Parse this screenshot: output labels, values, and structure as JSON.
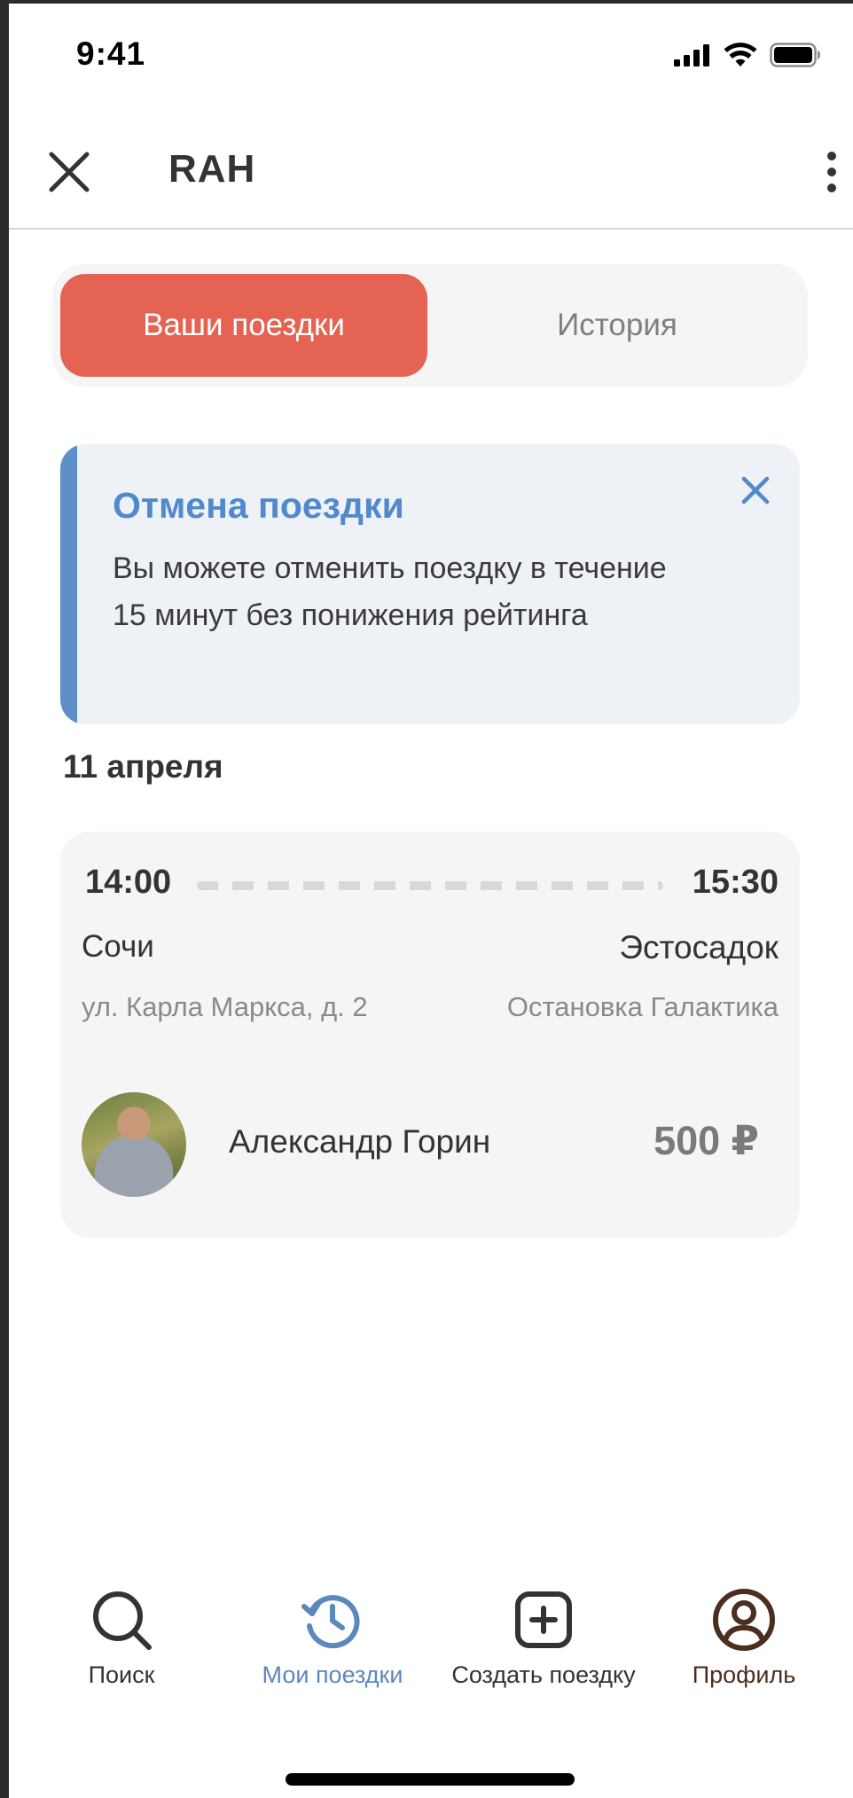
{
  "status_bar": {
    "time": "9:41"
  },
  "header": {
    "title": "RAH"
  },
  "tabs": [
    {
      "label": "Ваши поездки",
      "active": true
    },
    {
      "label": "История",
      "active": false
    }
  ],
  "banner": {
    "title": "Отмена поездки",
    "text": "Вы можете отменить поездку в течение 15 минут без понижения рейтинга"
  },
  "trips": {
    "date": "11 апреля",
    "item": {
      "depart_time": "14:00",
      "arrive_time": "15:30",
      "from_city": "Сочи",
      "to_city": "Эстосадок",
      "from_address": "ул. Карла Маркса, д. 2",
      "to_address": "Остановка Галактика",
      "driver_name": "Александр Горин",
      "price": "500 ₽"
    }
  },
  "bottom_nav": [
    {
      "label": "Поиск",
      "icon": "search-icon",
      "color": "#333333"
    },
    {
      "label": "Мои поездки",
      "icon": "history-icon",
      "color": "#5b88bd",
      "active": true
    },
    {
      "label": "Создать поездку",
      "icon": "plus-square-icon",
      "color": "#333333"
    },
    {
      "label": "Профиль",
      "icon": "profile-icon",
      "color": "#4a2e1f"
    }
  ],
  "colors": {
    "accent": "#e46353",
    "info_blue": "#5189cd",
    "banner_bg": "#eef2f6",
    "card_bg": "#f5f5f5"
  }
}
